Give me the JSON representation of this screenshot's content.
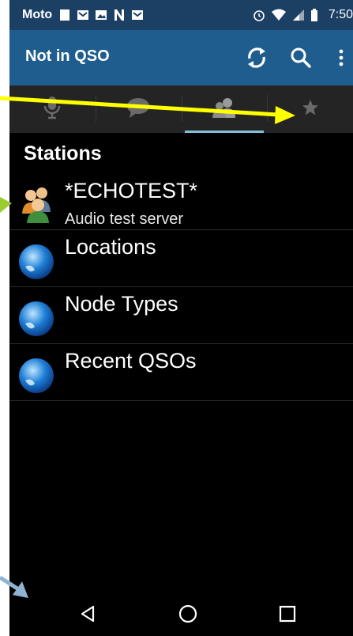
{
  "status_bar": {
    "carrier": "Moto",
    "time": "7:50",
    "icons": [
      "notification-square-icon",
      "gmail-icon",
      "photos-icon",
      "n-icon",
      "gmail-icon",
      "alarm-icon",
      "wifi-icon",
      "signal-icon",
      "battery-icon"
    ]
  },
  "action_bar": {
    "title": "Not in QSO",
    "actions": [
      "refresh-icon",
      "search-icon",
      "overflow-menu-icon"
    ]
  },
  "tabs": [
    {
      "icon": "microphone-icon",
      "selected": false
    },
    {
      "icon": "chat-bubble-icon",
      "selected": false
    },
    {
      "icon": "people-icon",
      "selected": true
    },
    {
      "icon": "star-icon",
      "selected": false
    }
  ],
  "list": {
    "header": "Stations",
    "items": [
      {
        "title": "*ECHOTEST*",
        "subtitle": "Audio test server",
        "icon": "people-group-icon"
      },
      {
        "title": "Locations",
        "icon": "globe-icon"
      },
      {
        "title": "Node Types",
        "icon": "globe-icon"
      },
      {
        "title": "Recent QSOs",
        "icon": "globe-icon"
      }
    ]
  },
  "nav_bar": {
    "buttons": [
      "back-icon",
      "home-icon",
      "recents-icon"
    ]
  },
  "colors": {
    "status_bar": "#1c3f64",
    "action_bar": "#1e5d8e",
    "tab_bar": "#242424",
    "tab_indicator": "#7fc0d8",
    "annotation_yellow": "#ffff00",
    "annotation_green": "#9acd32",
    "annotation_blue": "#8fb3d0"
  }
}
